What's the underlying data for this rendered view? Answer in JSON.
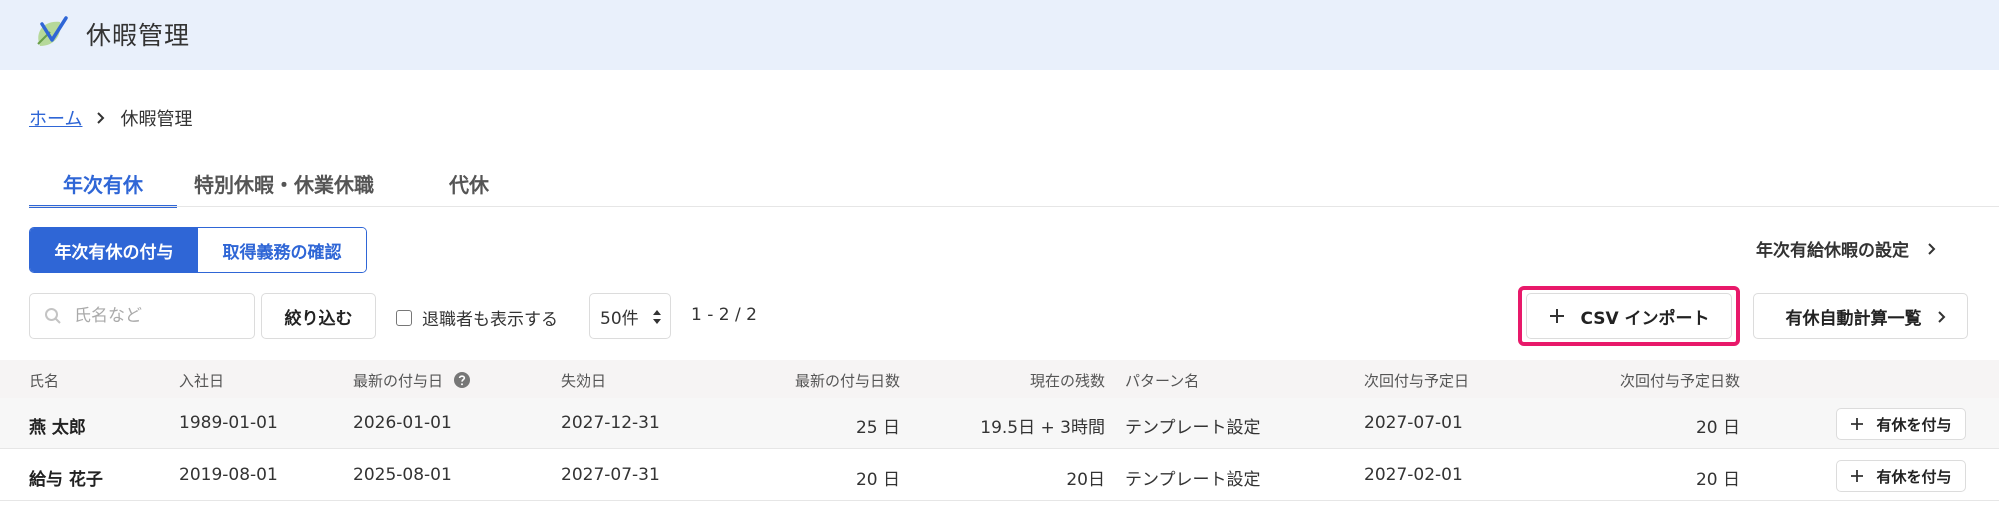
{
  "app": {
    "title": "休暇管理",
    "logo_icon": "leaf-check-icon",
    "brand_color": "#2f66d6"
  },
  "breadcrumb": {
    "home": "ホーム",
    "current": "休暇管理"
  },
  "tabs": [
    {
      "label": "年次有休",
      "active": true
    },
    {
      "label": "特別休暇・休業休職",
      "active": false
    },
    {
      "label": "代休",
      "active": false
    }
  ],
  "segment": {
    "grant": "年次有休の付与",
    "check": "取得義務の確認"
  },
  "settings_link": "年次有給休暇の設定",
  "toolbar": {
    "search_placeholder": "氏名など",
    "filter_label": "絞り込む",
    "retired_label": "退職者も表示する",
    "per_page": "50件",
    "pager": "1 - 2 / 2",
    "csv_import": "CSV インポート",
    "auto_calc": "有休自動計算一覧"
  },
  "table": {
    "headers": {
      "name": "氏名",
      "join_date": "入社日",
      "latest_grant_date": "最新の付与日",
      "expiry": "失効日",
      "latest_grant_days": "最新の付与日数",
      "remaining": "現在の残数",
      "pattern": "パターン名",
      "next_date": "次回付与予定日",
      "next_days": "次回付与予定日数"
    },
    "rows": [
      {
        "name": "燕 太郎",
        "join_date": "1989-01-01",
        "latest_grant_date": "2026-01-01",
        "expiry": "2027-12-31",
        "latest_grant_days": "25 日",
        "remaining": "19.5日 + 3時間",
        "pattern": "テンプレート設定",
        "next_date": "2027-07-01",
        "next_days": "20 日",
        "action": "有休を付与"
      },
      {
        "name": "給与 花子",
        "join_date": "2019-08-01",
        "latest_grant_date": "2025-08-01",
        "expiry": "2027-07-31",
        "latest_grant_days": "20 日",
        "remaining": "20日",
        "pattern": "テンプレート設定",
        "next_date": "2027-02-01",
        "next_days": "20 日",
        "action": "有休を付与"
      }
    ]
  }
}
